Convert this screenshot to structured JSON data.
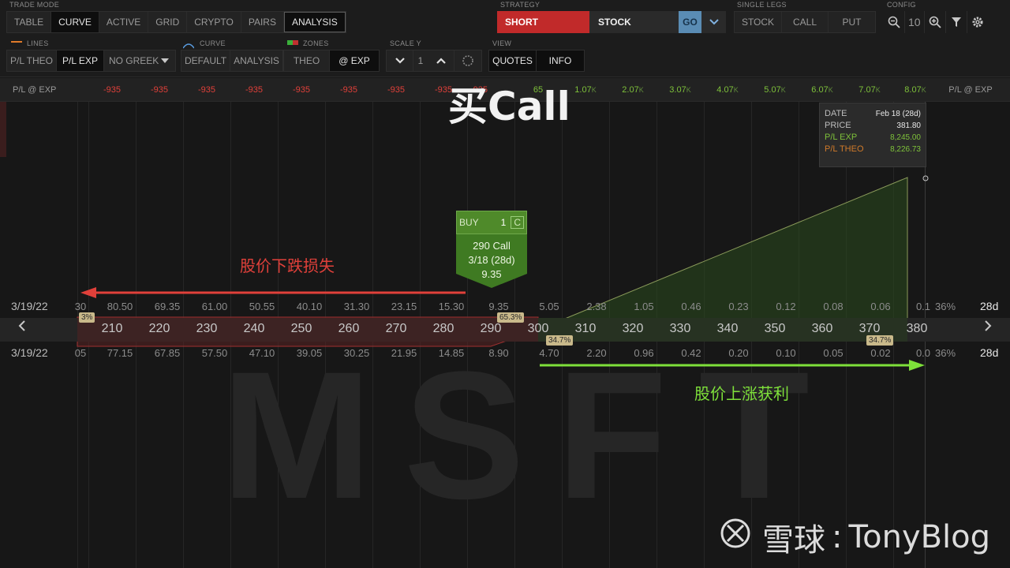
{
  "toolbar": {
    "trade_mode": {
      "label": "TRADE MODE",
      "tabs": [
        "TABLE",
        "CURVE",
        "ACTIVE",
        "GRID",
        "CRYPTO",
        "PAIRS",
        "ANALYSIS"
      ]
    },
    "strategy": {
      "label": "STRATEGY",
      "side": "SHORT",
      "type": "STOCK",
      "go": "GO"
    },
    "single_legs": {
      "label": "SINGLE LEGS",
      "items": [
        "STOCK",
        "CALL",
        "PUT"
      ]
    },
    "config": {
      "label": "CONFIG",
      "zoom": "10"
    },
    "lines": {
      "label": "LINES",
      "items": [
        "P/L THEO",
        "P/L EXP"
      ],
      "greek": "NO GREEK"
    },
    "curve": {
      "label": "CURVE",
      "items": [
        "DEFAULT",
        "ANALYSIS"
      ]
    },
    "zones": {
      "label": "ZONES",
      "items": [
        "THEO",
        "@ EXP"
      ]
    },
    "scale_y": {
      "label": "SCALE Y",
      "value": "1"
    },
    "view": {
      "label": "VIEW",
      "items": [
        "QUOTES",
        "INFO"
      ]
    }
  },
  "pl_row": {
    "label_left": "P/L @ EXP",
    "label_right": "P/L @ EXP",
    "values": [
      "-935",
      "-935",
      "-935",
      "-935",
      "-935",
      "-935",
      "-935",
      "-935"
    ],
    "partial_negative": "-935",
    "partial_positive": "65",
    "positive_values": [
      "1.07",
      "2.07",
      "3.07",
      "4.07",
      "5.07",
      "6.07",
      "7.07",
      "8.07"
    ],
    "k_suffix": "K"
  },
  "title_overlay": "买Call",
  "tooltip": {
    "rows": [
      {
        "label": "DATE",
        "value": "Feb 18 (28d)"
      },
      {
        "label": "PRICE",
        "value": "381.80"
      },
      {
        "label": "P/L EXP",
        "value": "8,245.00"
      },
      {
        "label": "P/L THEO",
        "value": "8,226.73"
      }
    ]
  },
  "call_row": {
    "date": "3/19/22",
    "days": "28d",
    "first_partial": "30",
    "values": [
      "80.50",
      "69.35",
      "61.00",
      "50.55",
      "40.10",
      "31.30",
      "23.15",
      "15.30",
      "9.35",
      "5.05",
      "2.38",
      "1.05",
      "0.46",
      "0.23",
      "0.12",
      "0.08",
      "0.06"
    ],
    "last_partial": "0.1",
    "iv": "36%"
  },
  "put_row": {
    "date": "3/19/22",
    "days": "28d",
    "first_partial": "05",
    "values": [
      "77.15",
      "67.85",
      "57.50",
      "47.10",
      "39.05",
      "30.25",
      "21.95",
      "14.85",
      "8.90",
      "4.70",
      "2.20",
      "0.96",
      "0.42",
      "0.20",
      "0.10",
      "0.05",
      "0.02"
    ],
    "last_partial": "0.0",
    "iv": "36%"
  },
  "strikes": [
    "210",
    "220",
    "230",
    "240",
    "250",
    "260",
    "270",
    "280",
    "290",
    "300",
    "310",
    "320",
    "330",
    "340",
    "350",
    "360",
    "370",
    "380"
  ],
  "pct_badges": {
    "left_cut": "3%",
    "mid_top": "65.3%",
    "mid_bottom": "34.7%",
    "right_bottom": "34.7%"
  },
  "buy_order": {
    "side": "BUY",
    "qty": "1",
    "type": "C",
    "line1": "290 Call",
    "line2": "3/18 (28d)",
    "line3": "9.35"
  },
  "annotations": {
    "down": "股价下跌损失",
    "up": "股价上涨获利"
  },
  "watermark": "MSFT",
  "brand": {
    "name": "雪球",
    "separator": ":",
    "user": "TonyBlog"
  },
  "colors": {
    "short": "#c12a2a",
    "go": "#5a8cb4",
    "loss": "#e0403a",
    "profit": "#7ec13a"
  }
}
